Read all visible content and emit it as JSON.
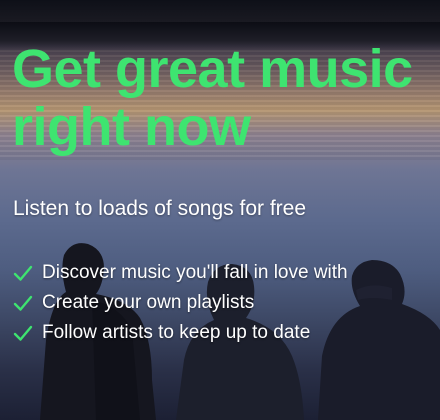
{
  "hero": {
    "headline_line1": "Get great music",
    "headline_line2": "right now",
    "subtitle": "Listen to loads of songs for free",
    "features": [
      {
        "label": "Discover music you'll fall in love with",
        "icon": "check-icon"
      },
      {
        "label": "Create your own playlists",
        "icon": "check-icon"
      },
      {
        "label": "Follow artists to keep up to date",
        "icon": "check-icon"
      }
    ]
  },
  "colors": {
    "accent": "#3ee470",
    "text": "#ffffff"
  }
}
